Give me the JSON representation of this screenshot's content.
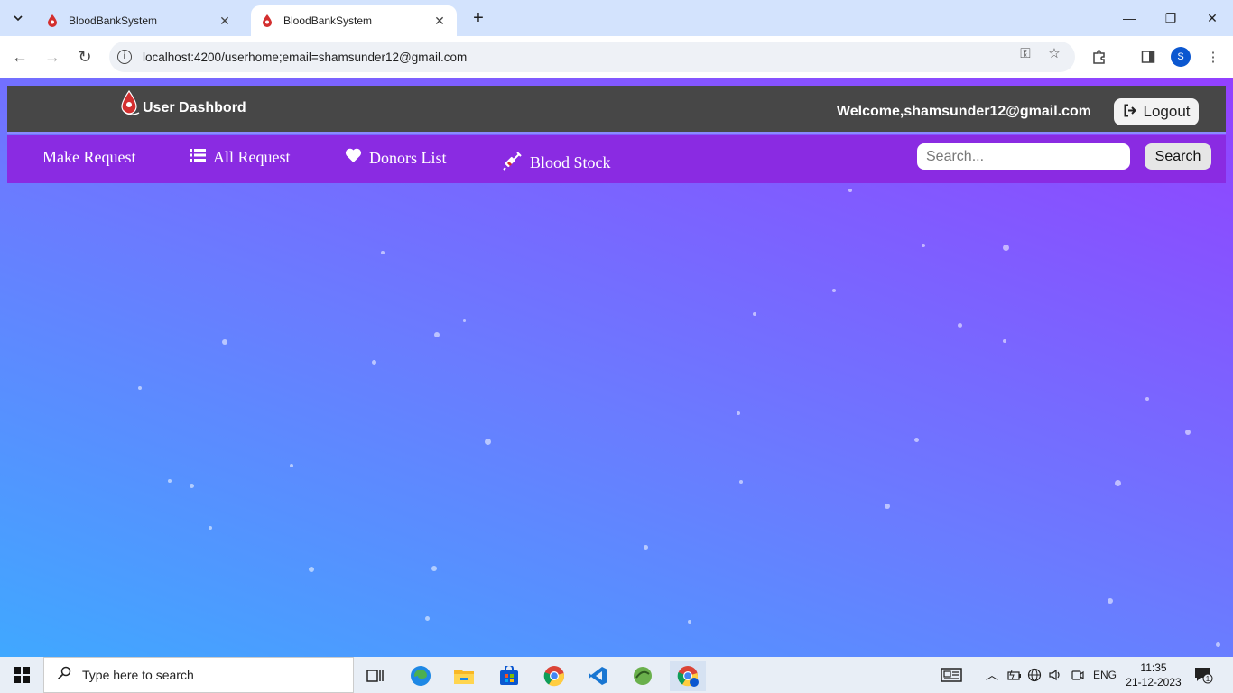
{
  "browser": {
    "tabs": [
      {
        "title": "BloodBankSystem",
        "active": false
      },
      {
        "title": "BloodBankSystem",
        "active": true
      }
    ],
    "new_tab_label": "+",
    "url": "localhost:4200/userhome;email=shamsunder12@gmail.com",
    "profile_initial": "S"
  },
  "app": {
    "title": "User Dashbord",
    "welcome": "Welcome,shamsunder12@gmail.com",
    "logout_label": "Logout",
    "menu": [
      {
        "label": "Make Request",
        "icon": ""
      },
      {
        "label": "All Request",
        "icon": "list-icon"
      },
      {
        "label": "Donors List",
        "icon": "heart-icon"
      },
      {
        "label": "Blood Stock",
        "icon": "syringe-icon"
      }
    ],
    "search": {
      "placeholder": "Search...",
      "value": "",
      "button_label": "Search"
    }
  },
  "taskbar": {
    "search_placeholder": "Type here to search",
    "language": "ENG",
    "time": "11:35",
    "date": "21-12-2023",
    "notification_count": "1"
  },
  "colors": {
    "appbar": "#474747",
    "menubar": "#8a2be2",
    "gradient_start": "#40a8ff",
    "gradient_end": "#9340ff",
    "logo_red": "#d32f2f"
  }
}
